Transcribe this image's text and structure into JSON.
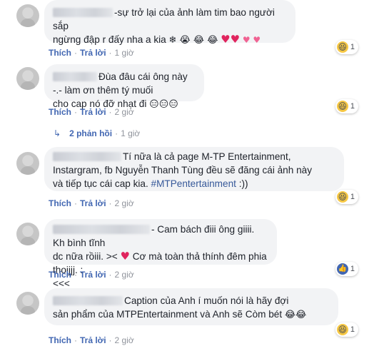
{
  "actions": {
    "like": "Thích",
    "reply": "Trả lời"
  },
  "comments": [
    {
      "text_lines": [
        "-sự trở lại của ảnh làm tim bao người sắp",
        "ngừng đập r đấy nha a kia"
      ],
      "emojis": "❄ 😭 😂 😂",
      "time": "1 giờ",
      "reaction_count": "1"
    },
    {
      "text_lines": [
        "Đùa đâu cái ông này -.- làm ơn thêm tý muối",
        "cho cap nó đỡ nhạt đi"
      ],
      "emojis": "😑😑😑",
      "time": "2 giờ",
      "reaction_count": "1",
      "replies_label": "2 phản hồi",
      "replies_time": "1 giờ"
    },
    {
      "text_lines": [
        "Tí nữa là cả page M-TP Entertainment,",
        "Instargram, fb Nguyễn Thanh Tùng đều sẽ đăng cái ảnh này",
        "và tiếp tục cái cap kia."
      ],
      "hashtag": "#MTPentertainment",
      "tail": ":))",
      "time": "2 giờ",
      "reaction_count": "1"
    },
    {
      "text_lines": [
        "- Cam bách điii ông giiii. Kh bình tĩnh",
        "dc nữa rồiii. ><",
        "Cơ mà toàn thả thính đêm phia thoijjj. :",
        "<<<"
      ],
      "time": "2 giờ",
      "reaction_count": "1"
    },
    {
      "text_lines": [
        "Caption của Anh í muốn nói là hãy đợi",
        "sản phẩm của MTPEntertainment và Anh sẽ Còm bét"
      ],
      "emojis": "😂😂",
      "time": "2 giờ",
      "reaction_count": "1"
    }
  ]
}
